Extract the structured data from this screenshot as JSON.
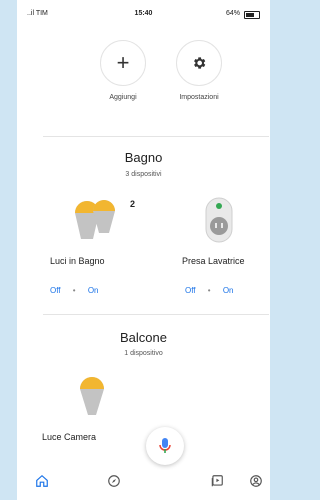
{
  "status_bar": {
    "carrier": "..il TIM",
    "time": "15:40",
    "battery": "64%"
  },
  "actions": [
    {
      "label": "Aggiungi",
      "icon": "plus-icon",
      "symbol": "+"
    },
    {
      "label": "Impostazioni",
      "icon": "gear-icon",
      "symbol": "⚙"
    }
  ],
  "rooms": [
    {
      "name": "Bagno",
      "count": "3 dispositivi",
      "devices": [
        {
          "name": "Luci in Bagno",
          "badge": "2",
          "off": "Off",
          "on": "On"
        },
        {
          "name": "Presa Lavatrice",
          "off": "Off",
          "on": "On"
        }
      ]
    },
    {
      "name": "Balcone",
      "count": "1 dispositivo",
      "devices": [
        {
          "name": "Luce Camera"
        }
      ]
    }
  ],
  "bottom_nav": [
    {
      "icon": "home-icon",
      "active": true
    },
    {
      "icon": "compass-icon",
      "active": false
    },
    {
      "icon": "media-icon",
      "active": false
    },
    {
      "icon": "account-icon",
      "active": false
    }
  ],
  "colors": {
    "accent": "#1a73e8",
    "bulb_yellow": "#f2b630",
    "bulb_gray": "#b8b8b8"
  }
}
